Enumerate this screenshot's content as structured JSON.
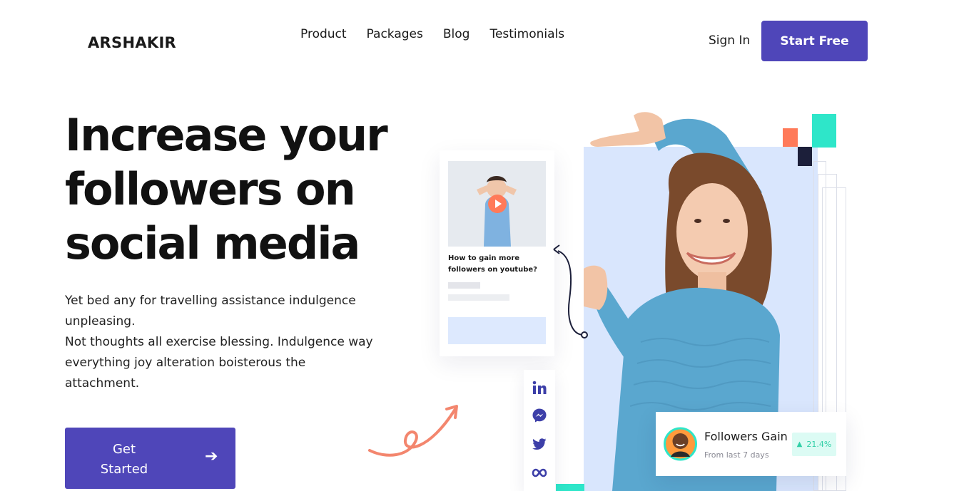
{
  "header": {
    "logo": "ARSHAKIR",
    "nav": [
      "Product",
      "Packages",
      "Blog",
      "Testimonials"
    ],
    "sign_in": "Sign In",
    "start_free": "Start Free"
  },
  "hero": {
    "title": "Increase your followers on social media",
    "description_lines": [
      "Yet bed any for travelling assistance indulgence unpleasing.",
      "Not thoughts all exercise blessing. Indulgence way everything joy alteration boisterous the attachment."
    ],
    "cta": "Get Started",
    "cta_icon": "arrow-right-icon"
  },
  "video_card": {
    "title": "How to gain more followers on youtube?",
    "play_icon": "play-icon"
  },
  "social_icons": [
    "linkedin-icon",
    "messenger-icon",
    "twitter-icon",
    "meta-icon"
  ],
  "followers_card": {
    "title": "Followers Gain",
    "subtitle": "From last 7 days",
    "change": "21.4%",
    "trend_icon": "triangle-up-icon"
  },
  "colors": {
    "brand": "#4f46b9",
    "accent_orange": "#ff7a59",
    "accent_teal": "#2ee6c9",
    "panel_blue": "#d9e6fd",
    "positive": "#2fcfa6"
  }
}
